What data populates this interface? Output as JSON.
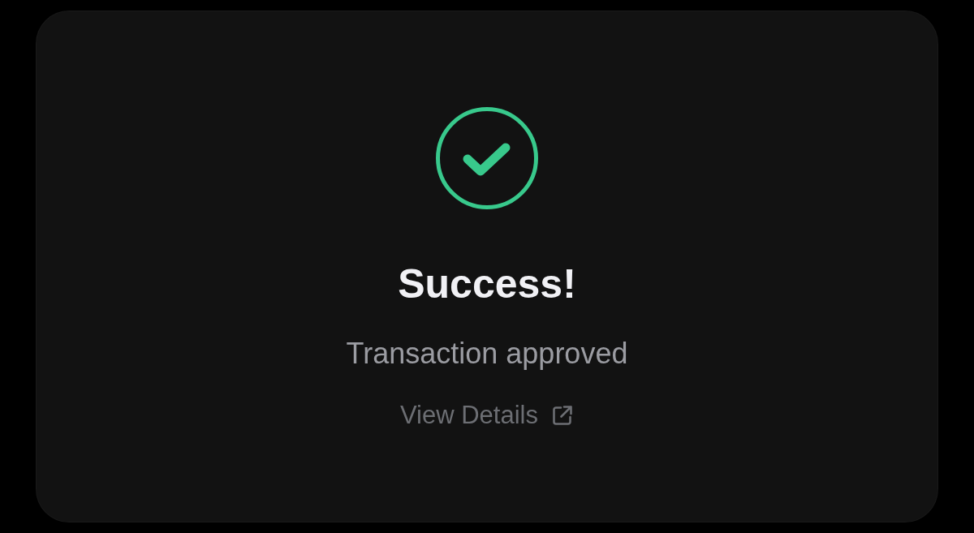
{
  "status": {
    "kind": "success",
    "title": "Success!",
    "message": "Transaction approved"
  },
  "link": {
    "label": "View Details"
  }
}
